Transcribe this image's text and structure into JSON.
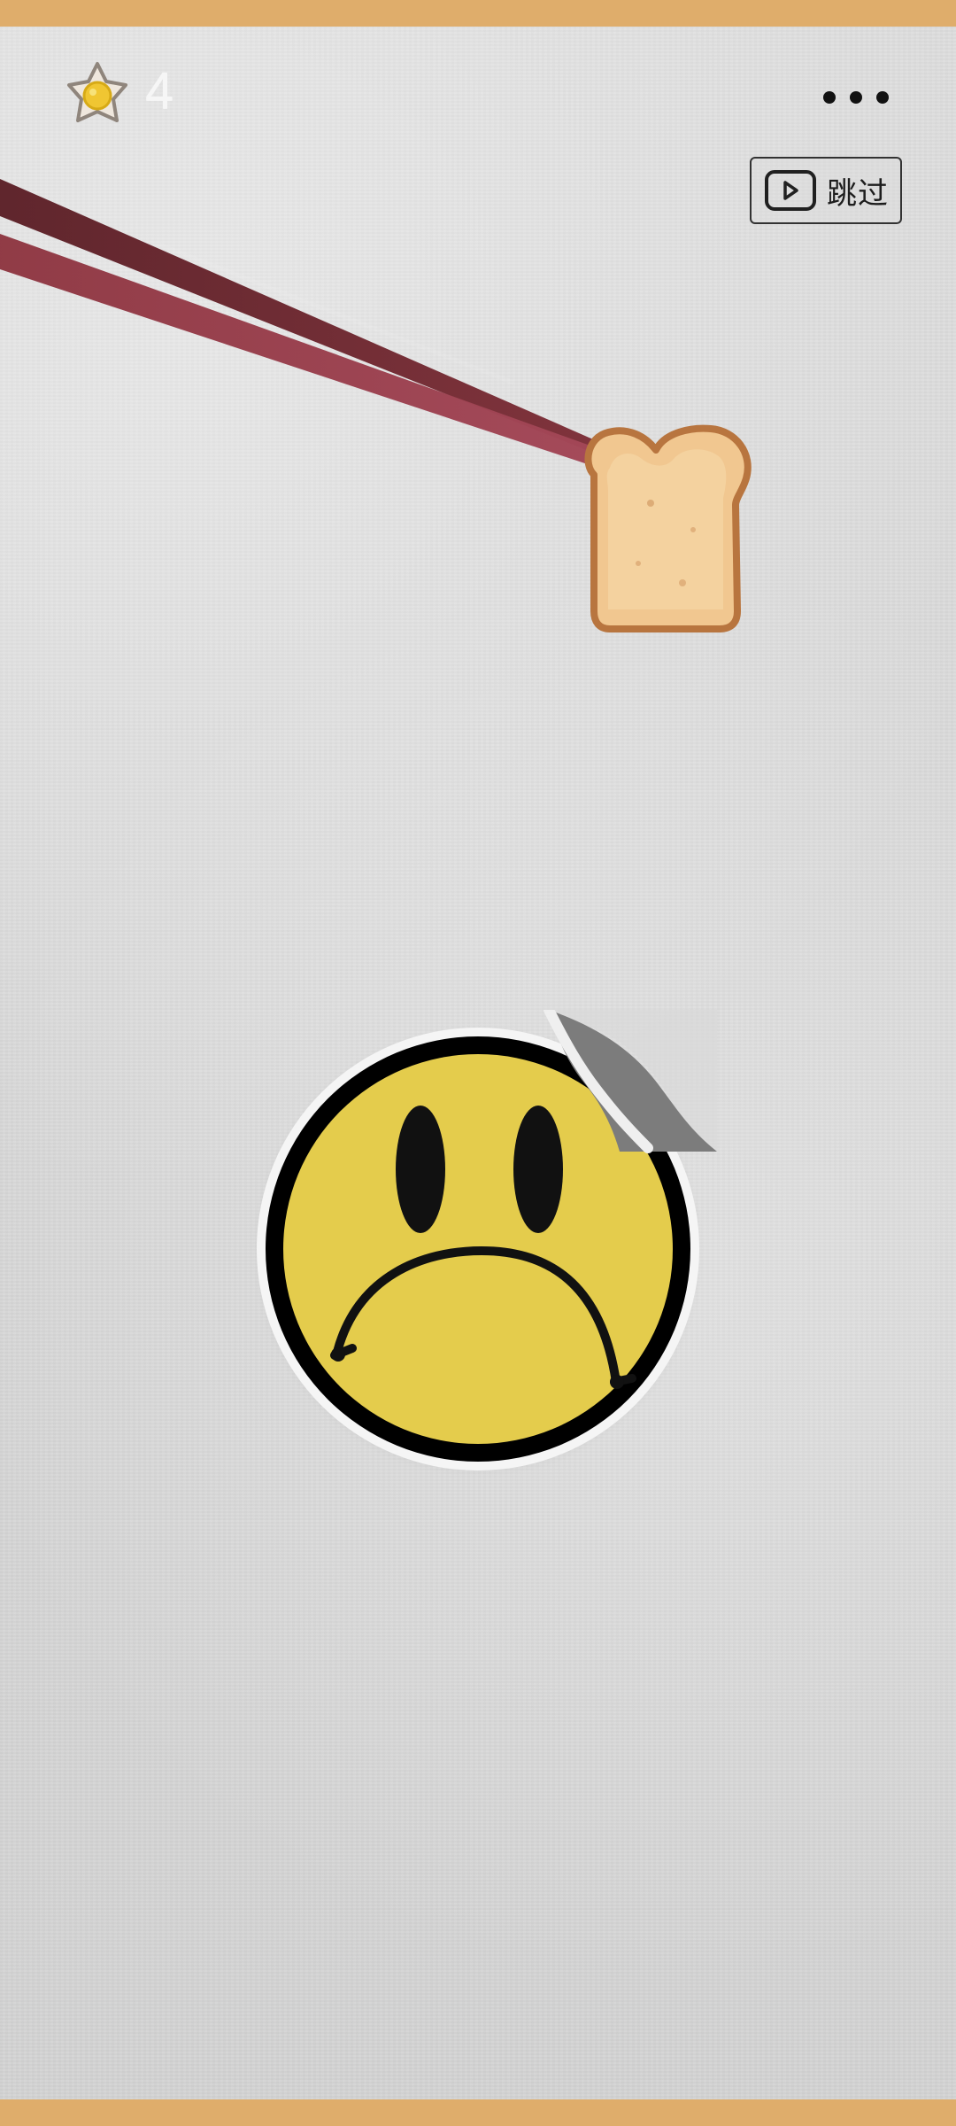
{
  "hud": {
    "coin_icon": "fried-egg-star-icon",
    "coin_count": "4",
    "more_icon": "more-icon",
    "skip_icon": "play-icon",
    "skip_label": "跳过"
  },
  "scene": {
    "background": "paper-wall",
    "chopsticks": "chopsticks",
    "held_item": "toast-slice",
    "sticker": "sad-face-sticker"
  },
  "colors": {
    "frame": "#dfad6b",
    "wall": "#d9d9d9",
    "chopstick_dark": "#6f2d34",
    "chopstick_light": "#8f3b46",
    "toast_crust": "#b8753f",
    "toast_inside": "#f1c790",
    "sticker_yellow": "#e4cc4c",
    "sticker_outline": "#000000"
  }
}
